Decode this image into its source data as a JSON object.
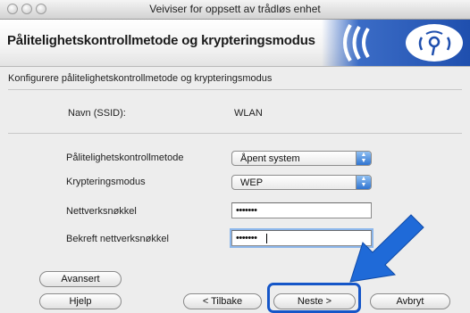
{
  "window": {
    "title": "Veiviser for oppsett av trådløs enhet"
  },
  "banner": {
    "title": "Pålitelighetskontrollmetode og krypteringsmodus",
    "logo_icon": "wifi-signal-icon"
  },
  "section": {
    "heading": "Konfigurere pålitelighetskontrollmetode og krypteringsmodus"
  },
  "fields": {
    "ssid_label": "Navn (SSID):",
    "ssid_value": "WLAN",
    "auth_label": "Pålitelighetskontrollmetode",
    "auth_value": "Åpent system",
    "enc_label": "Krypteringsmodus",
    "enc_value": "WEP",
    "key_label": "Nettverksnøkkel",
    "key_value": "•••••••",
    "confirm_label": "Bekreft nettverksnøkkel",
    "confirm_value": "•••••••"
  },
  "buttons": {
    "advanced": "Avansert",
    "help": "Hjelp",
    "back": "< Tilbake",
    "next": "Neste >",
    "cancel": "Avbryt"
  },
  "colors": {
    "highlight": "#1556c8",
    "arrow": "#1f6ad8",
    "banner_accent": "#1f4fae"
  }
}
